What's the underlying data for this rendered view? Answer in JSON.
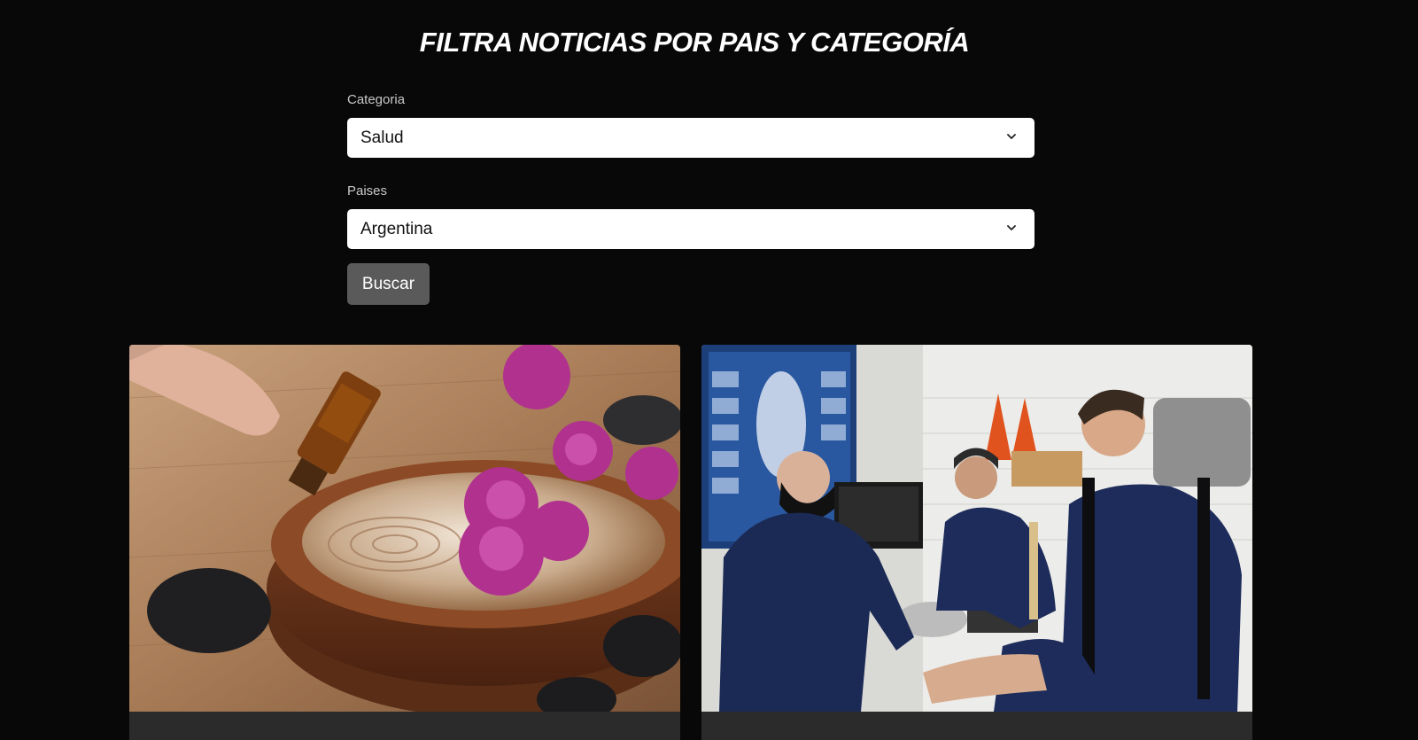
{
  "title": "FILTRA NOTICIAS POR PAIS Y CATEGORÍA",
  "form": {
    "category_label": "Categoria",
    "category_value": "Salud",
    "country_label": "Paises",
    "country_value": "Argentina",
    "search_button": "Buscar"
  },
  "colors": {
    "background": "#080808",
    "button": "#5a5a5a",
    "card": "#2b2b2b"
  },
  "cards": [
    {
      "image": "aromatherapy-oil-bowl-flowers-image"
    },
    {
      "image": "athlete-physiotherapy-session-image"
    }
  ]
}
